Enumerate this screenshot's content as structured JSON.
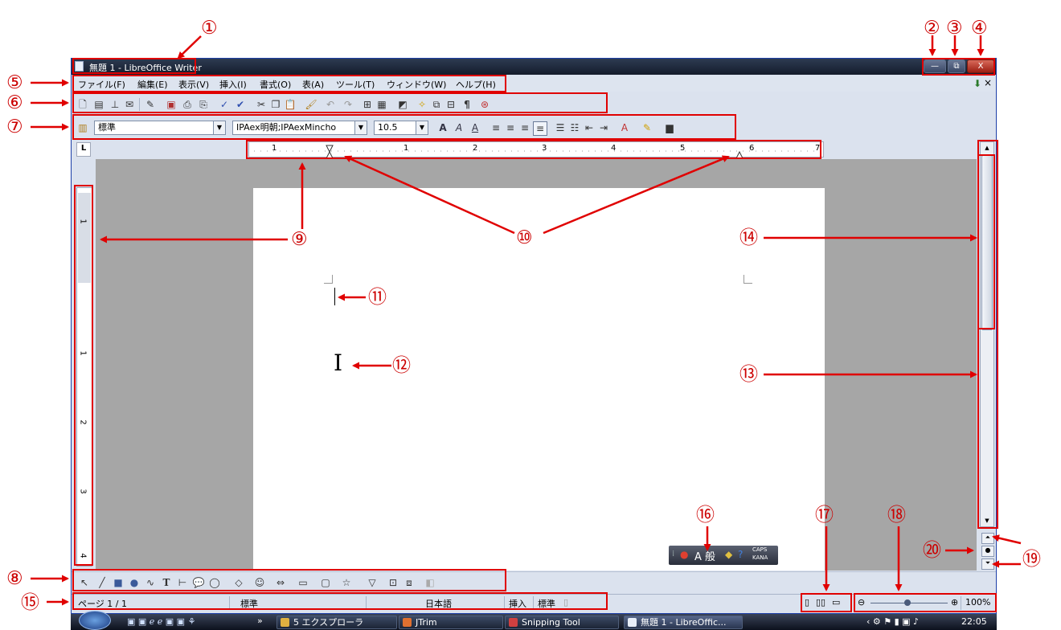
{
  "window": {
    "title": "無題 1 - LibreOffice Writer",
    "caption_buttons": {
      "minimize": "—",
      "restore": "⧉",
      "close": "X"
    }
  },
  "menu": {
    "items": [
      "ファイル(F)",
      "編集(E)",
      "表示(V)",
      "挿入(I)",
      "書式(O)",
      "表(A)",
      "ツール(T)",
      "ウィンドウ(W)",
      "ヘルプ(H)"
    ],
    "close_doc": "×"
  },
  "formatting": {
    "style": "標準",
    "font": "IPAex明朝;IPAexMincho",
    "size": "10.5"
  },
  "ruler": {
    "horizontal_ticks": [
      "1",
      "1",
      "2",
      "3",
      "4",
      "5",
      "6",
      "7"
    ],
    "vertical_ticks": [
      "1",
      "1",
      "2",
      "3",
      "4"
    ]
  },
  "status": {
    "page": "ページ 1 / 1",
    "style": "標準",
    "language": "日本語",
    "insert_mode": "挿入",
    "selection_mode": "標準",
    "zoom": "100%"
  },
  "ime": {
    "caps": "CAPS",
    "kana": "KANA",
    "mode": "A 般"
  },
  "taskbar": {
    "items": [
      "5 エクスプローラ",
      "JTrim",
      "Snipping Tool",
      "無題 1 - LibreOffic..."
    ],
    "clock": "22:05"
  },
  "callouts": [
    "①",
    "②",
    "③",
    "④",
    "⑤",
    "⑥",
    "⑦",
    "⑧",
    "⑨",
    "⑩",
    "⑪",
    "⑫",
    "⑬",
    "⑭",
    "⑮",
    "⑯",
    "⑰",
    "⑱",
    "⑲",
    "⑳"
  ],
  "colors": {
    "annotation": "#e00000",
    "title_bar": "#1c2536",
    "document_bg": "#a6a6a6",
    "chrome": "#dbe2ee"
  }
}
